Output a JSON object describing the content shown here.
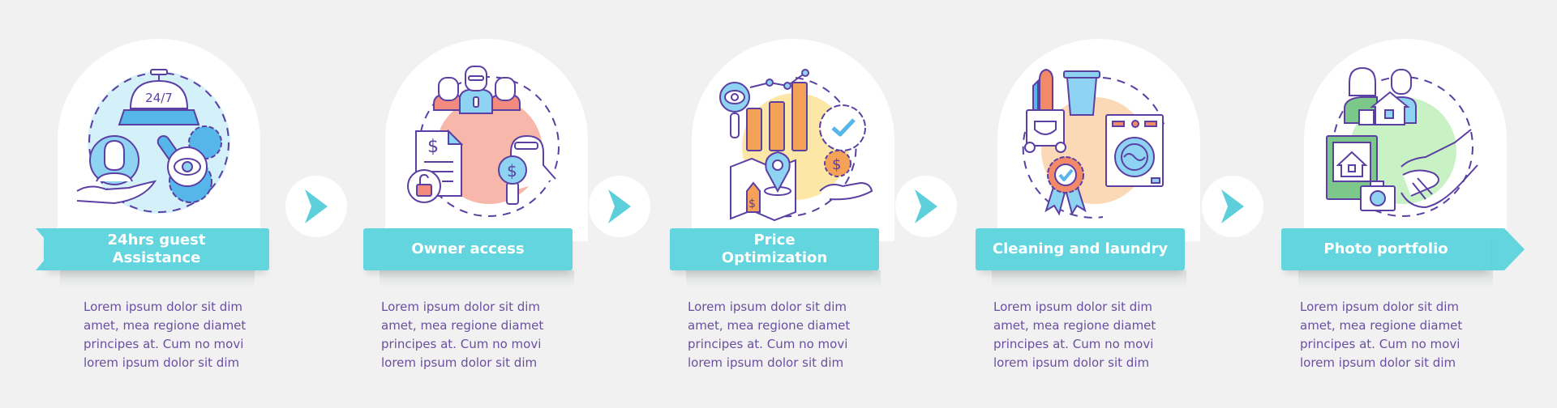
{
  "colors": {
    "background": "#f1f1f1",
    "banner": "#62d5de",
    "text": "#6a4fa0",
    "outline": "#5b3fa3",
    "arrow": "#5ccfdb"
  },
  "steps": [
    {
      "title": "24hrs guest\nAssistance",
      "icon": "concierge-bell-support-icon",
      "bell_label": "24/7",
      "accent": "#56b6ea",
      "description": "Lorem ipsum dolor sit dim\namet, mea regione diamet\nprincipes at. Cum no movi\nlorem ipsum dolor sit dim"
    },
    {
      "title": "Owner access",
      "icon": "owners-finance-access-icon",
      "accent": "#f28a7e",
      "description": "Lorem ipsum dolor sit dim\namet, mea regione diamet\nprincipes at. Cum no movi\nlorem ipsum dolor sit dim"
    },
    {
      "title": "Price\nOptimization",
      "icon": "price-optimization-icon",
      "accent": "#f5a259",
      "description": "Lorem ipsum dolor sit dim\namet, mea regione diamet\nprincipes at. Cum no movi\nlorem ipsum dolor sit dim"
    },
    {
      "title": "Cleaning and laundry",
      "icon": "cleaning-laundry-icon",
      "accent": "#f28a6a",
      "description": "Lorem ipsum dolor sit dim\namet, mea regione diamet\nprincipes at. Cum no movi\nlorem ipsum dolor sit dim"
    },
    {
      "title": "Photo portfolio",
      "icon": "photo-portfolio-handshake-icon",
      "accent": "#7cc88a",
      "description": "Lorem ipsum dolor sit dim\namet, mea regione diamet\nprincipes at. Cum no movi\nlorem ipsum dolor sit dim"
    }
  ],
  "connectors": [
    "next-arrow",
    "next-arrow",
    "next-arrow",
    "next-arrow"
  ]
}
